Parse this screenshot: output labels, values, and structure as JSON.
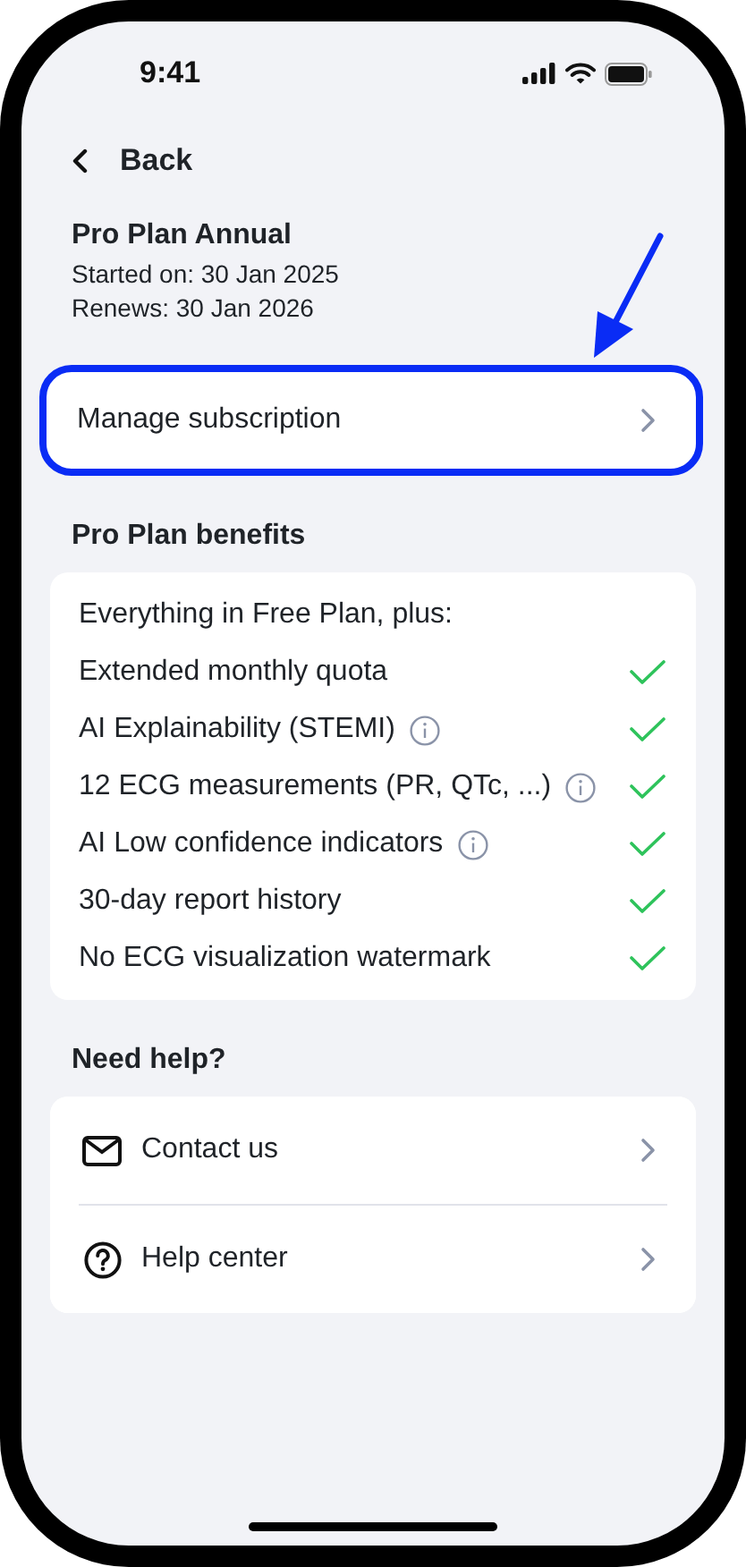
{
  "status_bar": {
    "time": "9:41"
  },
  "nav": {
    "back_label": "Back"
  },
  "plan": {
    "name": "Pro Plan Annual",
    "started": "Started on: 30 Jan 2025",
    "renews": "Renews: 30 Jan 2026"
  },
  "manage": {
    "label": "Manage subscription",
    "highlighted": true
  },
  "benefits": {
    "title": "Pro Plan benefits",
    "intro": "Everything in Free Plan, plus:",
    "items": [
      {
        "label": "Extended monthly quota",
        "info": false,
        "included": true
      },
      {
        "label": "AI Explainability (STEMI)",
        "info": true,
        "included": true
      },
      {
        "label": "12 ECG measurements (PR, QTc, ...)",
        "info": true,
        "included": true
      },
      {
        "label": "AI Low confidence indicators",
        "info": true,
        "included": true
      },
      {
        "label": "30-day report history",
        "info": false,
        "included": true
      },
      {
        "label": "No ECG visualization watermark",
        "info": false,
        "included": true
      }
    ]
  },
  "help": {
    "title": "Need help?",
    "items": [
      {
        "label": "Contact us",
        "kind": "mail"
      },
      {
        "label": "Help center",
        "kind": "question"
      }
    ]
  }
}
